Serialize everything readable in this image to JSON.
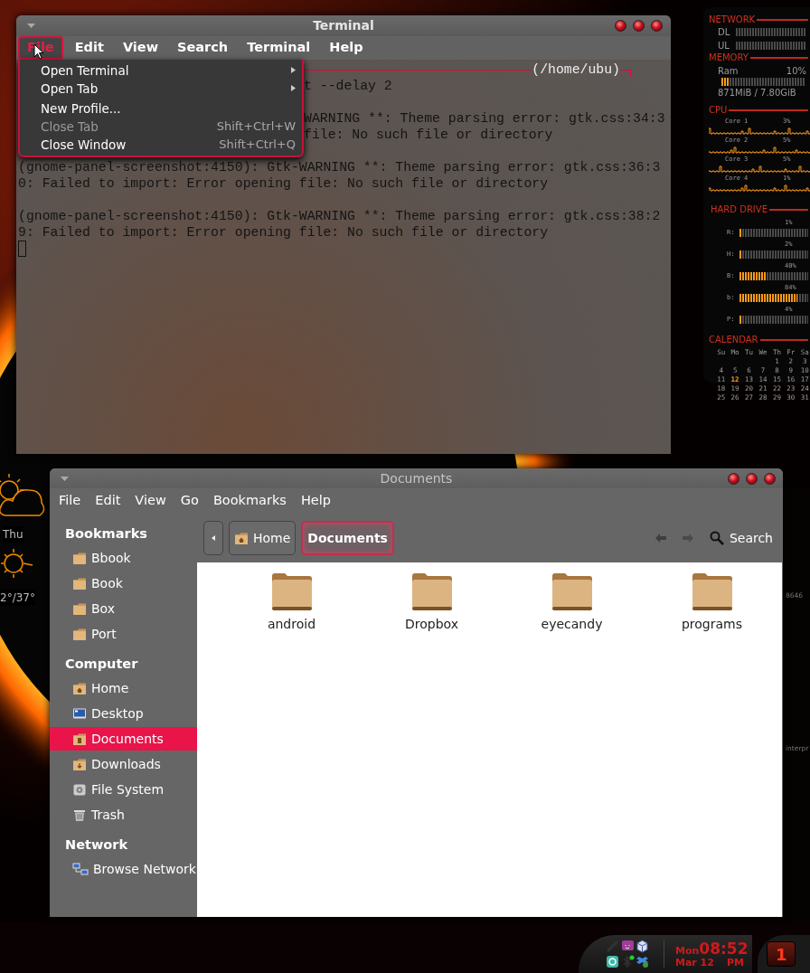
{
  "desktop": {
    "weather": {
      "day": "Thu",
      "temperature": "2°/37°"
    },
    "edge_texts": [
      "8646",
      "interpr"
    ]
  },
  "widgets": {
    "network": {
      "title": "NETWORK",
      "rows": [
        {
          "label": "DL"
        },
        {
          "label": "UL"
        }
      ]
    },
    "memory": {
      "title": "MEMORY",
      "label": "Ram",
      "reading": "10%",
      "level": 0.1,
      "detail": "871MiB / 7.80GiB"
    },
    "cpu": {
      "title": "CPU",
      "cores": [
        {
          "label": "Core 1",
          "reading": "3%"
        },
        {
          "label": "Core 2",
          "reading": "5%"
        },
        {
          "label": "Core 3",
          "reading": "5%"
        },
        {
          "label": "Core 4",
          "reading": "1%"
        }
      ]
    },
    "hard_drive": {
      "title": "HARD DRIVE",
      "drives": [
        {
          "label": "R:",
          "reading": "1%",
          "level": 0.01
        },
        {
          "label": "H:",
          "reading": "2%",
          "level": 0.02
        },
        {
          "label": "B:",
          "reading": "40%",
          "level": 0.4
        },
        {
          "label": "b:",
          "reading": "84%",
          "level": 0.84
        },
        {
          "label": "P:",
          "reading": "4%",
          "level": 0.04
        }
      ]
    },
    "calendar": {
      "title": "CALENDAR",
      "weekdays": [
        "Su",
        "Mo",
        "Tu",
        "We",
        "Th",
        "Fr",
        "Sa"
      ],
      "weeks": [
        [
          {
            "text": "1",
            "selected": false
          },
          {
            "text": "2",
            "selected": false
          },
          {
            "text": "3",
            "selected": false
          }
        ],
        [
          {
            "text": "4",
            "selected": false
          },
          {
            "text": "5",
            "selected": false
          },
          {
            "text": "6",
            "selected": false
          },
          {
            "text": "7",
            "selected": false
          },
          {
            "text": "8",
            "selected": false
          },
          {
            "text": "9",
            "selected": false
          },
          {
            "text": "10",
            "selected": false
          }
        ],
        [
          {
            "text": "11",
            "selected": false
          },
          {
            "text": "12",
            "selected": true
          },
          {
            "text": "13",
            "selected": false
          },
          {
            "text": "14",
            "selected": false
          },
          {
            "text": "15",
            "selected": false
          },
          {
            "text": "16",
            "selected": false
          },
          {
            "text": "17",
            "selected": false
          }
        ],
        [
          {
            "text": "18",
            "selected": false
          },
          {
            "text": "19",
            "selected": false
          },
          {
            "text": "20",
            "selected": false
          },
          {
            "text": "21",
            "selected": false
          },
          {
            "text": "22",
            "selected": false
          },
          {
            "text": "23",
            "selected": false
          },
          {
            "text": "24",
            "selected": false
          }
        ],
        [
          {
            "text": "25",
            "selected": false
          },
          {
            "text": "26",
            "selected": false
          },
          {
            "text": "27",
            "selected": false
          },
          {
            "text": "28",
            "selected": false
          },
          {
            "text": "29",
            "selected": false
          },
          {
            "text": "30",
            "selected": false
          },
          {
            "text": "31",
            "selected": false
          }
        ]
      ]
    }
  },
  "terminal": {
    "title": "Terminal",
    "menu": [
      {
        "label": "File",
        "selected": true
      },
      {
        "label": "Edit",
        "selected": false
      },
      {
        "label": "View",
        "selected": false
      },
      {
        "label": "Search",
        "selected": false
      },
      {
        "label": "Terminal",
        "selected": false
      },
      {
        "label": "Help",
        "selected": false
      }
    ],
    "file_menu": [
      {
        "label": "Open Terminal",
        "submenu": true,
        "disabled": false
      },
      {
        "label": "Open Tab",
        "submenu": true,
        "disabled": false
      },
      {
        "label": "New Profile...",
        "submenu": false,
        "disabled": false
      },
      {
        "label": "Close Tab",
        "shortcut": "Shift+Ctrl+W",
        "submenu": false,
        "disabled": true
      },
      {
        "label": "Close Window",
        "shortcut": "Shift+Ctrl+Q",
        "submenu": false,
        "disabled": false
      }
    ],
    "lines": [
      {
        "kind": "prompt",
        "text": "(/home/ubu)"
      },
      {
        "kind": "output",
        "text": "t --delay 2",
        "covered": true
      },
      {
        "kind": "blank"
      },
      {
        "kind": "output",
        "text": "WARNING **: Theme parsing error: gtk.css:34:3",
        "covered": true
      },
      {
        "kind": "output",
        "text": "file: No such file or directory",
        "covered": true
      },
      {
        "kind": "blank"
      },
      {
        "kind": "output",
        "text": "(gnome-panel-screenshot:4150): Gtk-WARNING **: Theme parsing error: gtk.css:36:3",
        "covered": false
      },
      {
        "kind": "output",
        "text": "0: Failed to import: Error opening file: No such file or directory",
        "covered": false
      },
      {
        "kind": "blank"
      },
      {
        "kind": "output",
        "text": "(gnome-panel-screenshot:4150): Gtk-WARNING **: Theme parsing error: gtk.css:38:2",
        "covered": false
      },
      {
        "kind": "output",
        "text": "9: Failed to import: Error opening file: No such file or directory",
        "covered": false
      },
      {
        "kind": "cursor"
      }
    ]
  },
  "files": {
    "title": "Documents",
    "menu": [
      "File",
      "Edit",
      "View",
      "Go",
      "Bookmarks",
      "Help"
    ],
    "sidebar": [
      {
        "heading": "Bookmarks",
        "items": [
          {
            "label": "Bbook",
            "kind": "folder",
            "selected": false
          },
          {
            "label": "Book",
            "kind": "folder",
            "selected": false
          },
          {
            "label": "Box",
            "kind": "folder",
            "selected": false
          },
          {
            "label": "Port",
            "kind": "folder",
            "selected": false
          }
        ]
      },
      {
        "heading": "Computer",
        "items": [
          {
            "label": "Home",
            "kind": "home",
            "selected": false
          },
          {
            "label": "Desktop",
            "kind": "desktop",
            "selected": false
          },
          {
            "label": "Documents",
            "kind": "documents",
            "selected": true
          },
          {
            "label": "Downloads",
            "kind": "downloads",
            "selected": false
          },
          {
            "label": "File System",
            "kind": "drive",
            "selected": false
          },
          {
            "label": "Trash",
            "kind": "trash",
            "selected": false
          }
        ]
      },
      {
        "heading": "Network",
        "items": [
          {
            "label": "Browse Network",
            "kind": "network",
            "selected": false
          }
        ]
      }
    ],
    "path": [
      {
        "label": "Home",
        "kind": "home",
        "selected": false
      },
      {
        "label": "Documents",
        "kind": "plain",
        "selected": true
      }
    ],
    "search": "Search",
    "items": [
      "android",
      "Dropbox",
      "eyecandy",
      "programs"
    ]
  },
  "taskbar": {
    "day": "Mon",
    "date": "Mar 12",
    "time": "08:52",
    "period": "PM",
    "workspace": "1"
  }
}
